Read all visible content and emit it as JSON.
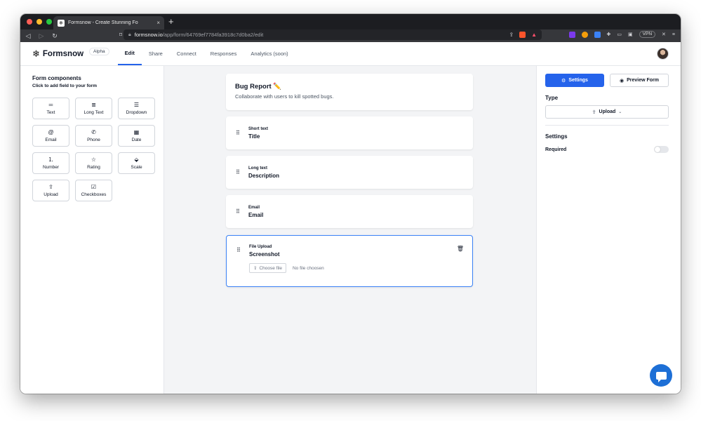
{
  "browser": {
    "tab_title": "Formsnow - Create Stunning Fo",
    "tab_close": "×",
    "new_tab": "+",
    "url_host": "formsnow.io",
    "url_path": "/app/form/64769ef7784fa3918c7d0ba2/edit",
    "vpn_label": "VPN"
  },
  "app": {
    "logo_icon": "❄",
    "logo_text": "Formsnow",
    "badge": "Alpha",
    "nav_tabs": [
      {
        "label": "Edit",
        "active": true
      },
      {
        "label": "Share"
      },
      {
        "label": "Connect"
      },
      {
        "label": "Responses"
      },
      {
        "label": "Analytics (soon)"
      }
    ]
  },
  "components_panel": {
    "title": "Form components",
    "subtitle": "Click to add field to your form",
    "items": [
      {
        "label": "Text",
        "icon": "text-icon"
      },
      {
        "label": "Long Text",
        "icon": "long-text-icon"
      },
      {
        "label": "Dropdown",
        "icon": "dropdown-icon"
      },
      {
        "label": "Email",
        "icon": "at-icon"
      },
      {
        "label": "Phone",
        "icon": "phone-icon"
      },
      {
        "label": "Date",
        "icon": "calendar-icon"
      },
      {
        "label": "Number",
        "icon": "number-list-icon"
      },
      {
        "label": "Rating",
        "icon": "star-icon"
      },
      {
        "label": "Scale",
        "icon": "scale-icon"
      },
      {
        "label": "Upload",
        "icon": "upload-icon"
      },
      {
        "label": "Checkboxes",
        "icon": "checkbox-icon"
      }
    ]
  },
  "form": {
    "title": "Bug Report ✏️",
    "description": "Collaborate with users to kill spotted bugs.",
    "fields": [
      {
        "type": "Short text",
        "name": "Title"
      },
      {
        "type": "Long text",
        "name": "Description"
      },
      {
        "type": "Email",
        "name": "Email"
      },
      {
        "type": "File Upload",
        "name": "Screenshot",
        "choose_label": "Choose file",
        "no_file": "No file choosen"
      }
    ]
  },
  "settings_panel": {
    "settings_button": "Settings",
    "preview_button": "Preview Form",
    "type_label": "Type",
    "type_value": "Upload",
    "settings_heading": "Settings",
    "required_label": "Required",
    "required_on": false
  },
  "colors": {
    "accent": "#2563eb",
    "chat": "#1d6fd6"
  }
}
